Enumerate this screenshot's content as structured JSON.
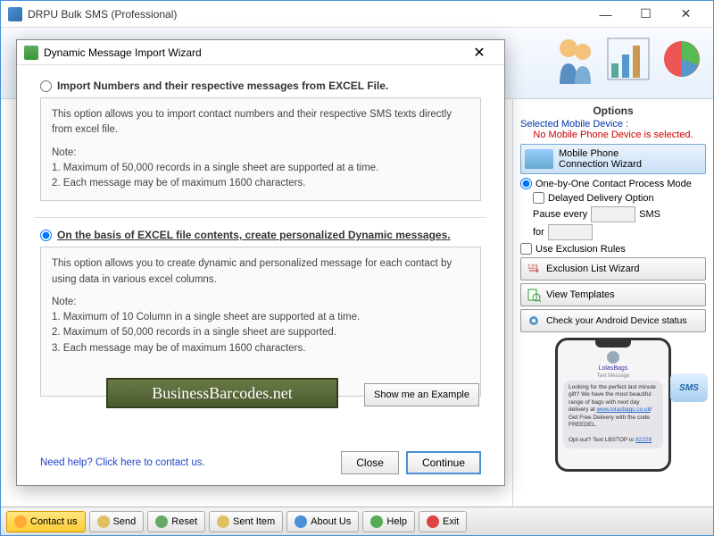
{
  "app": {
    "title": "DRPU Bulk SMS (Professional)"
  },
  "modal": {
    "title": "Dynamic Message Import Wizard",
    "option1": {
      "label": "Import Numbers and their respective messages from EXCEL File.",
      "desc": "This option allows you to import contact numbers and their respective SMS texts directly from excel file.",
      "note_label": "Note:",
      "note1": "1. Maximum of 50,000 records in a single sheet are supported at a time.",
      "note2": "2. Each message may be of maximum 1600 characters."
    },
    "option2": {
      "label": "On the basis of EXCEL file contents, create personalized Dynamic messages.",
      "desc": "This option allows you to create dynamic and personalized message for each contact by using data in various excel columns.",
      "note_label": "Note:",
      "note1": "1. Maximum of 10 Column in a single sheet are supported at a time.",
      "note2": "2. Maximum of 50,000 records in a single sheet are supported.",
      "note3": "3. Each message may be of maximum 1600 characters."
    },
    "watermark": "BusinessBarcodes.net",
    "example_btn": "Show me an Example",
    "help_link": "Need help? Click here to contact us.",
    "close_btn": "Close",
    "continue_btn": "Continue"
  },
  "side": {
    "title": "Options",
    "selected_label": "Selected Mobile Device :",
    "selected_value": "No Mobile Phone Device is selected.",
    "wizard_line1": "Mobile Phone",
    "wizard_line2": "Connection  Wizard",
    "mode_label": "One-by-One Contact Process Mode",
    "delayed_label": "Delayed Delivery Option",
    "pause_label": "Pause every",
    "pause_unit": "SMS",
    "for_label": "for",
    "exclusion_check": "Use Exclusion Rules",
    "exclusion_btn": "Exclusion List Wizard",
    "templates_btn": "View Templates",
    "android_btn": "Check your Android Device status",
    "sms_badge": "SMS",
    "phone": {
      "contact": "LolasBags",
      "meta": "Text Message",
      "msg_prefix": "Looking for the perfect last minute gift? We have the most beautiful range of bags with next day delivery at ",
      "msg_link1": "www.lolasbags.co.uk",
      "msg_mid": "! Get Free Delivery with the code FREEDEL.",
      "msg_optout": "Opt-out? Text LBSTOP to ",
      "msg_link2": "82228"
    }
  },
  "toolbar": {
    "contact": "Contact us",
    "send": "Send",
    "reset": "Reset",
    "sent_item": "Sent Item",
    "about": "About Us",
    "help": "Help",
    "exit": "Exit"
  }
}
